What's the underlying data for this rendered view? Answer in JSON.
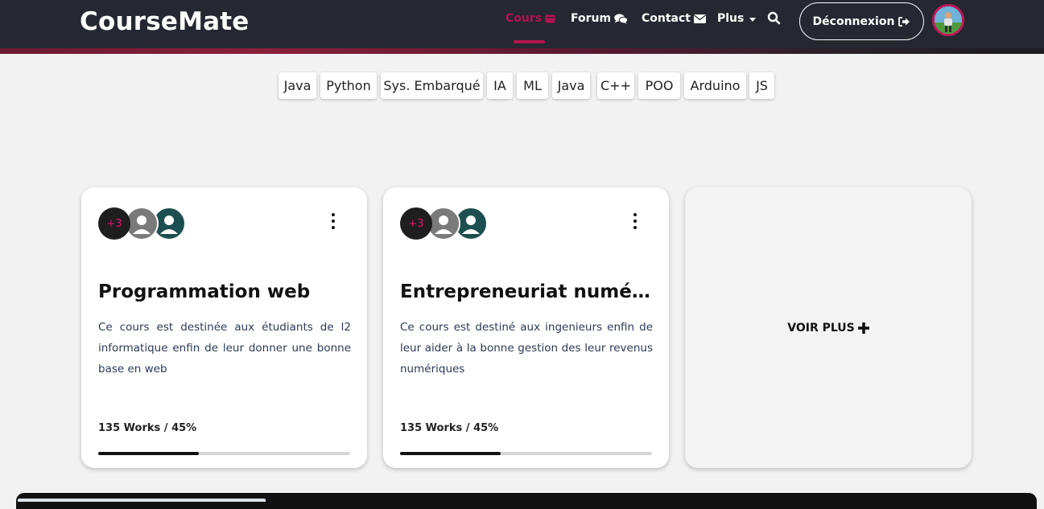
{
  "brand": "CourseMate",
  "nav": {
    "cours": "Cours",
    "forum": "Forum",
    "contact": "Contact",
    "plus": "Plus",
    "logout": "Déconnexion",
    "accent_color": "#b0154f"
  },
  "tags": [
    "Java",
    "Python",
    "Sys. Embarqué",
    "IA",
    "ML",
    "Java",
    "C++",
    "POO",
    "Arduino",
    "JS"
  ],
  "cards": [
    {
      "extra_members": "+3",
      "title": "Programmation web",
      "description": "Ce cours est destinée aux étudiants de l2 informatique enfin de leur donner une bonne base en web",
      "works": "135 Works / 45%",
      "progress": 0.4
    },
    {
      "extra_members": "+3",
      "title": "Entrepreneuriat numérique",
      "description": "Ce cours est destiné aux ingenieurs enfin de leur aider à la bonne gestion des leur revenus numériques",
      "works": "135 Works / 45%",
      "progress": 0.4
    }
  ],
  "more_card": {
    "label": "VOIR PLUS"
  },
  "icons": {
    "cours": "book-icon",
    "forum": "comments-icon",
    "contact": "envelope-icon",
    "search": "search-icon",
    "logout": "sign-out-icon",
    "more": "plus-icon"
  }
}
